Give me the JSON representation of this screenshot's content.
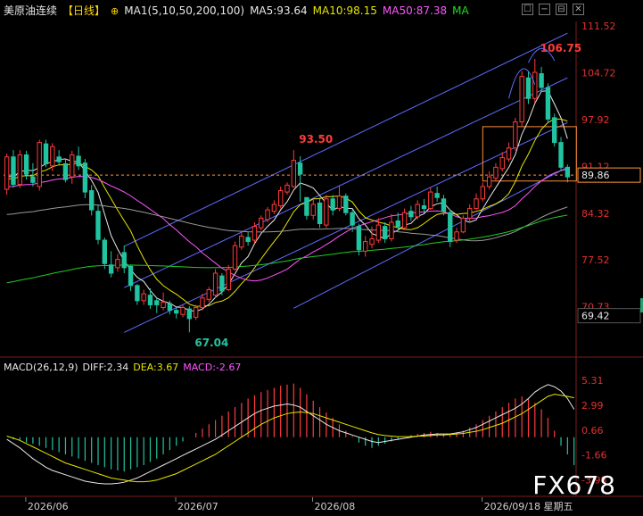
{
  "header": {
    "title": "美原油连续",
    "period": "【日线】",
    "ma1": "MA1(5,10,50,200,100)",
    "ma5": "MA5:93.64",
    "ma10": "MA10:98.15",
    "ma50": "MA50:87.38",
    "ma": "MA"
  },
  "window_buttons": [
    "☐",
    "−",
    "⊟",
    "✕"
  ],
  "macd_header": {
    "name": "MACD(26,12,9)",
    "diff": "DIFF:2.34",
    "dea": "DEA:3.67",
    "macd": "MACD:-2.67"
  },
  "watermark": "FX678",
  "colors": {
    "up": "#ff3b3b",
    "down": "#21c4a0",
    "ma5": "#e8e8e8",
    "ma10": "#e6e600",
    "ma50": "#ff55ff",
    "ma200": "#22cc22",
    "ma100": "#9a9a9a",
    "channel": "#5f6cff"
  },
  "chart_data": {
    "type": "candlestick",
    "y_ticks": [
      "111.52",
      "104.72",
      "97.92",
      "91.12",
      "84.32",
      "77.52",
      "70.73"
    ],
    "ylim": [
      64.7,
      112.2
    ],
    "x_labels": [
      {
        "index": 4,
        "label": "2026/06"
      },
      {
        "index": 27,
        "label": "2026/07"
      },
      {
        "index": 48,
        "label": "2026/08"
      },
      {
        "index": 74,
        "label": "2026/09/18 星期五"
      }
    ],
    "current_price": "89.86",
    "low_marker": "69.42",
    "annotations": [
      {
        "index": 28,
        "text": "67.04",
        "value": 67.04,
        "kind": "low"
      },
      {
        "index": 44,
        "text": "93.50",
        "value": 93.5,
        "kind": "high"
      },
      {
        "index": 81,
        "text": "106.75",
        "value": 106.75,
        "kind": "high"
      }
    ],
    "candles": [
      [
        87.8,
        92.5,
        87.0,
        93.0
      ],
      [
        92.5,
        88.5,
        88.0,
        93.5
      ],
      [
        88.5,
        92.8,
        88.0,
        93.5
      ],
      [
        92.8,
        90.0,
        89.2,
        93.4
      ],
      [
        89.6,
        88.8,
        88.2,
        91.6
      ],
      [
        88.2,
        94.6,
        87.6,
        95.0
      ],
      [
        94.4,
        91.5,
        91.0,
        95.0
      ],
      [
        91.2,
        94.0,
        90.4,
        94.5
      ],
      [
        92.5,
        91.8,
        91.4,
        93.5
      ],
      [
        91.5,
        89.2,
        88.8,
        92.2
      ],
      [
        89.6,
        92.8,
        88.6,
        93.4
      ],
      [
        92.6,
        91.2,
        90.6,
        94.0
      ],
      [
        91.6,
        87.4,
        86.5,
        92.2
      ],
      [
        87.6,
        84.8,
        84.0,
        88.4
      ],
      [
        84.6,
        80.5,
        79.8,
        85.6
      ],
      [
        80.4,
        77.0,
        76.2,
        80.8
      ],
      [
        76.8,
        75.6,
        75.0,
        78.8
      ],
      [
        76.4,
        77.6,
        75.8,
        78.4
      ],
      [
        78.6,
        76.4,
        75.6,
        79.6
      ],
      [
        76.6,
        73.8,
        73.0,
        76.8
      ],
      [
        73.8,
        71.6,
        71.0,
        74.0
      ],
      [
        71.6,
        72.6,
        71.0,
        73.2
      ],
      [
        72.4,
        71.0,
        70.4,
        73.4
      ],
      [
        71.6,
        71.0,
        69.8,
        72.0
      ],
      [
        70.6,
        71.4,
        70.2,
        72.8
      ],
      [
        71.2,
        70.2,
        69.6,
        71.6
      ],
      [
        70.2,
        69.8,
        69.0,
        70.6
      ],
      [
        69.6,
        70.6,
        69.2,
        71.0
      ],
      [
        70.4,
        69.0,
        67.0,
        70.8
      ],
      [
        69.2,
        70.6,
        68.8,
        71.0
      ],
      [
        70.6,
        72.0,
        70.2,
        72.6
      ],
      [
        71.8,
        73.2,
        71.4,
        73.6
      ],
      [
        72.4,
        75.6,
        72.0,
        76.2
      ],
      [
        75.2,
        73.0,
        72.4,
        75.6
      ],
      [
        73.2,
        76.2,
        73.0,
        76.8
      ],
      [
        76.2,
        79.6,
        76.0,
        80.2
      ],
      [
        79.4,
        81.0,
        79.0,
        81.6
      ],
      [
        80.8,
        80.2,
        79.6,
        81.6
      ],
      [
        80.4,
        82.4,
        80.0,
        83.0
      ],
      [
        82.2,
        83.6,
        81.8,
        84.0
      ],
      [
        83.4,
        84.8,
        83.0,
        85.2
      ],
      [
        84.6,
        85.6,
        84.2,
        86.2
      ],
      [
        85.4,
        87.6,
        85.0,
        88.2
      ],
      [
        87.4,
        88.4,
        87.0,
        88.8
      ],
      [
        88.2,
        92.0,
        88.0,
        93.5
      ],
      [
        91.6,
        90.0,
        86.0,
        92.6
      ],
      [
        86.6,
        84.0,
        83.4,
        86.6
      ],
      [
        84.0,
        85.6,
        83.4,
        86.4
      ],
      [
        85.8,
        82.8,
        82.2,
        86.6
      ],
      [
        82.6,
        86.4,
        82.2,
        87.0
      ],
      [
        86.4,
        84.8,
        84.0,
        87.0
      ],
      [
        85.0,
        86.8,
        84.6,
        88.4
      ],
      [
        86.8,
        84.4,
        84.0,
        87.2
      ],
      [
        84.4,
        82.6,
        81.6,
        84.8
      ],
      [
        82.4,
        79.0,
        78.2,
        82.8
      ],
      [
        78.8,
        80.2,
        78.0,
        81.0
      ],
      [
        79.8,
        80.6,
        79.2,
        82.4
      ],
      [
        80.4,
        82.6,
        80.0,
        83.6
      ],
      [
        82.4,
        80.6,
        80.0,
        83.0
      ],
      [
        80.6,
        83.0,
        80.2,
        84.2
      ],
      [
        83.2,
        82.4,
        81.8,
        84.4
      ],
      [
        82.2,
        84.4,
        82.0,
        85.0
      ],
      [
        84.6,
        83.8,
        83.2,
        85.4
      ],
      [
        83.8,
        85.6,
        83.4,
        86.2
      ],
      [
        85.4,
        85.0,
        84.4,
        86.4
      ],
      [
        85.0,
        87.4,
        84.8,
        88.0
      ],
      [
        87.2,
        86.6,
        86.0,
        88.2
      ],
      [
        86.4,
        84.6,
        84.0,
        87.0
      ],
      [
        84.4,
        80.2,
        79.4,
        84.8
      ],
      [
        80.4,
        81.6,
        80.0,
        82.2
      ],
      [
        81.6,
        83.6,
        81.4,
        84.0
      ],
      [
        83.6,
        85.0,
        83.0,
        85.6
      ],
      [
        85.0,
        86.4,
        84.8,
        87.2
      ],
      [
        86.4,
        88.2,
        86.0,
        88.8
      ],
      [
        88.2,
        89.6,
        87.8,
        90.4
      ],
      [
        89.4,
        91.0,
        89.0,
        91.6
      ],
      [
        90.8,
        92.4,
        90.4,
        93.2
      ],
      [
        92.2,
        93.8,
        91.8,
        94.6
      ],
      [
        93.8,
        97.6,
        93.4,
        98.2
      ],
      [
        97.6,
        104.2,
        97.0,
        105.0
      ],
      [
        104.0,
        101.0,
        100.2,
        105.0
      ],
      [
        101.0,
        104.8,
        100.4,
        106.75
      ],
      [
        104.6,
        102.6,
        102.0,
        105.6
      ],
      [
        102.6,
        98.0,
        97.4,
        103.2
      ],
      [
        98.2,
        94.6,
        94.0,
        98.8
      ],
      [
        94.6,
        91.0,
        90.4,
        95.4
      ],
      [
        91.0,
        89.6,
        88.8,
        91.4
      ]
    ],
    "macd": {
      "y_ticks": [
        "5.31",
        "2.99",
        "0.66",
        "-1.66",
        "-3.98"
      ],
      "ylim": [
        -4.6,
        5.8
      ],
      "hist": [
        0.0,
        -0.2,
        -0.3,
        -0.5,
        -0.6,
        -0.8,
        -1.0,
        -1.2,
        -1.4,
        -1.6,
        -1.8,
        -2.0,
        -2.2,
        -2.4,
        -2.6,
        -2.8,
        -3.0,
        -3.1,
        -3.2,
        -3.0,
        -2.8,
        -2.6,
        -2.3,
        -2.0,
        -1.6,
        -1.2,
        -0.8,
        -0.4,
        0.0,
        0.4,
        0.8,
        1.2,
        1.6,
        2.0,
        2.4,
        2.8,
        3.2,
        3.6,
        3.9,
        4.2,
        4.4,
        4.6,
        4.8,
        4.9,
        5.0,
        4.6,
        4.0,
        3.4,
        2.8,
        2.3,
        1.8,
        1.2,
        0.6,
        0.1,
        -0.5,
        -0.8,
        -1.0,
        -0.8,
        -0.6,
        -0.4,
        -0.2,
        0.0,
        0.2,
        0.3,
        0.4,
        0.5,
        0.4,
        0.3,
        0.2,
        0.4,
        0.6,
        0.9,
        1.2,
        1.6,
        2.0,
        2.4,
        2.8,
        3.2,
        3.6,
        3.8,
        3.6,
        3.2,
        2.6,
        1.8,
        0.6,
        -0.8,
        -1.6,
        -2.6
      ],
      "diff": [
        -0.2,
        -0.6,
        -1.0,
        -1.5,
        -2.0,
        -2.4,
        -2.8,
        -3.1,
        -3.3,
        -3.5,
        -3.7,
        -3.9,
        -4.1,
        -4.2,
        -4.3,
        -4.35,
        -4.35,
        -4.3,
        -4.2,
        -4.0,
        -3.8,
        -3.5,
        -3.2,
        -2.9,
        -2.6,
        -2.3,
        -2.0,
        -1.7,
        -1.4,
        -1.1,
        -0.8,
        -0.5,
        -0.2,
        0.2,
        0.6,
        1.0,
        1.4,
        1.8,
        2.2,
        2.5,
        2.7,
        2.9,
        3.0,
        3.1,
        3.0,
        2.8,
        2.4,
        2.0,
        1.6,
        1.2,
        0.9,
        0.6,
        0.4,
        0.2,
        0.0,
        -0.2,
        -0.4,
        -0.5,
        -0.4,
        -0.3,
        -0.2,
        -0.1,
        0.0,
        0.1,
        0.2,
        0.25,
        0.3,
        0.3,
        0.3,
        0.4,
        0.5,
        0.7,
        0.9,
        1.2,
        1.5,
        1.8,
        2.1,
        2.4,
        2.7,
        3.1,
        3.6,
        4.2,
        4.6,
        4.9,
        4.7,
        4.3,
        3.6,
        2.6
      ],
      "dea": [
        0.1,
        -0.1,
        -0.3,
        -0.6,
        -0.9,
        -1.2,
        -1.5,
        -1.8,
        -2.1,
        -2.4,
        -2.6,
        -2.8,
        -3.0,
        -3.2,
        -3.4,
        -3.6,
        -3.8,
        -3.9,
        -4.0,
        -4.1,
        -4.15,
        -4.15,
        -4.1,
        -4.0,
        -3.8,
        -3.6,
        -3.4,
        -3.1,
        -2.8,
        -2.5,
        -2.2,
        -1.9,
        -1.6,
        -1.2,
        -0.8,
        -0.4,
        0.0,
        0.4,
        0.8,
        1.2,
        1.5,
        1.8,
        2.0,
        2.2,
        2.3,
        2.35,
        2.3,
        2.2,
        2.0,
        1.8,
        1.6,
        1.4,
        1.2,
        1.0,
        0.8,
        0.6,
        0.4,
        0.25,
        0.15,
        0.1,
        0.05,
        0.05,
        0.05,
        0.1,
        0.1,
        0.15,
        0.2,
        0.2,
        0.25,
        0.3,
        0.35,
        0.45,
        0.55,
        0.7,
        0.9,
        1.1,
        1.3,
        1.6,
        1.9,
        2.2,
        2.6,
        3.0,
        3.4,
        3.8,
        4.0,
        3.9,
        3.8,
        3.67
      ]
    }
  }
}
